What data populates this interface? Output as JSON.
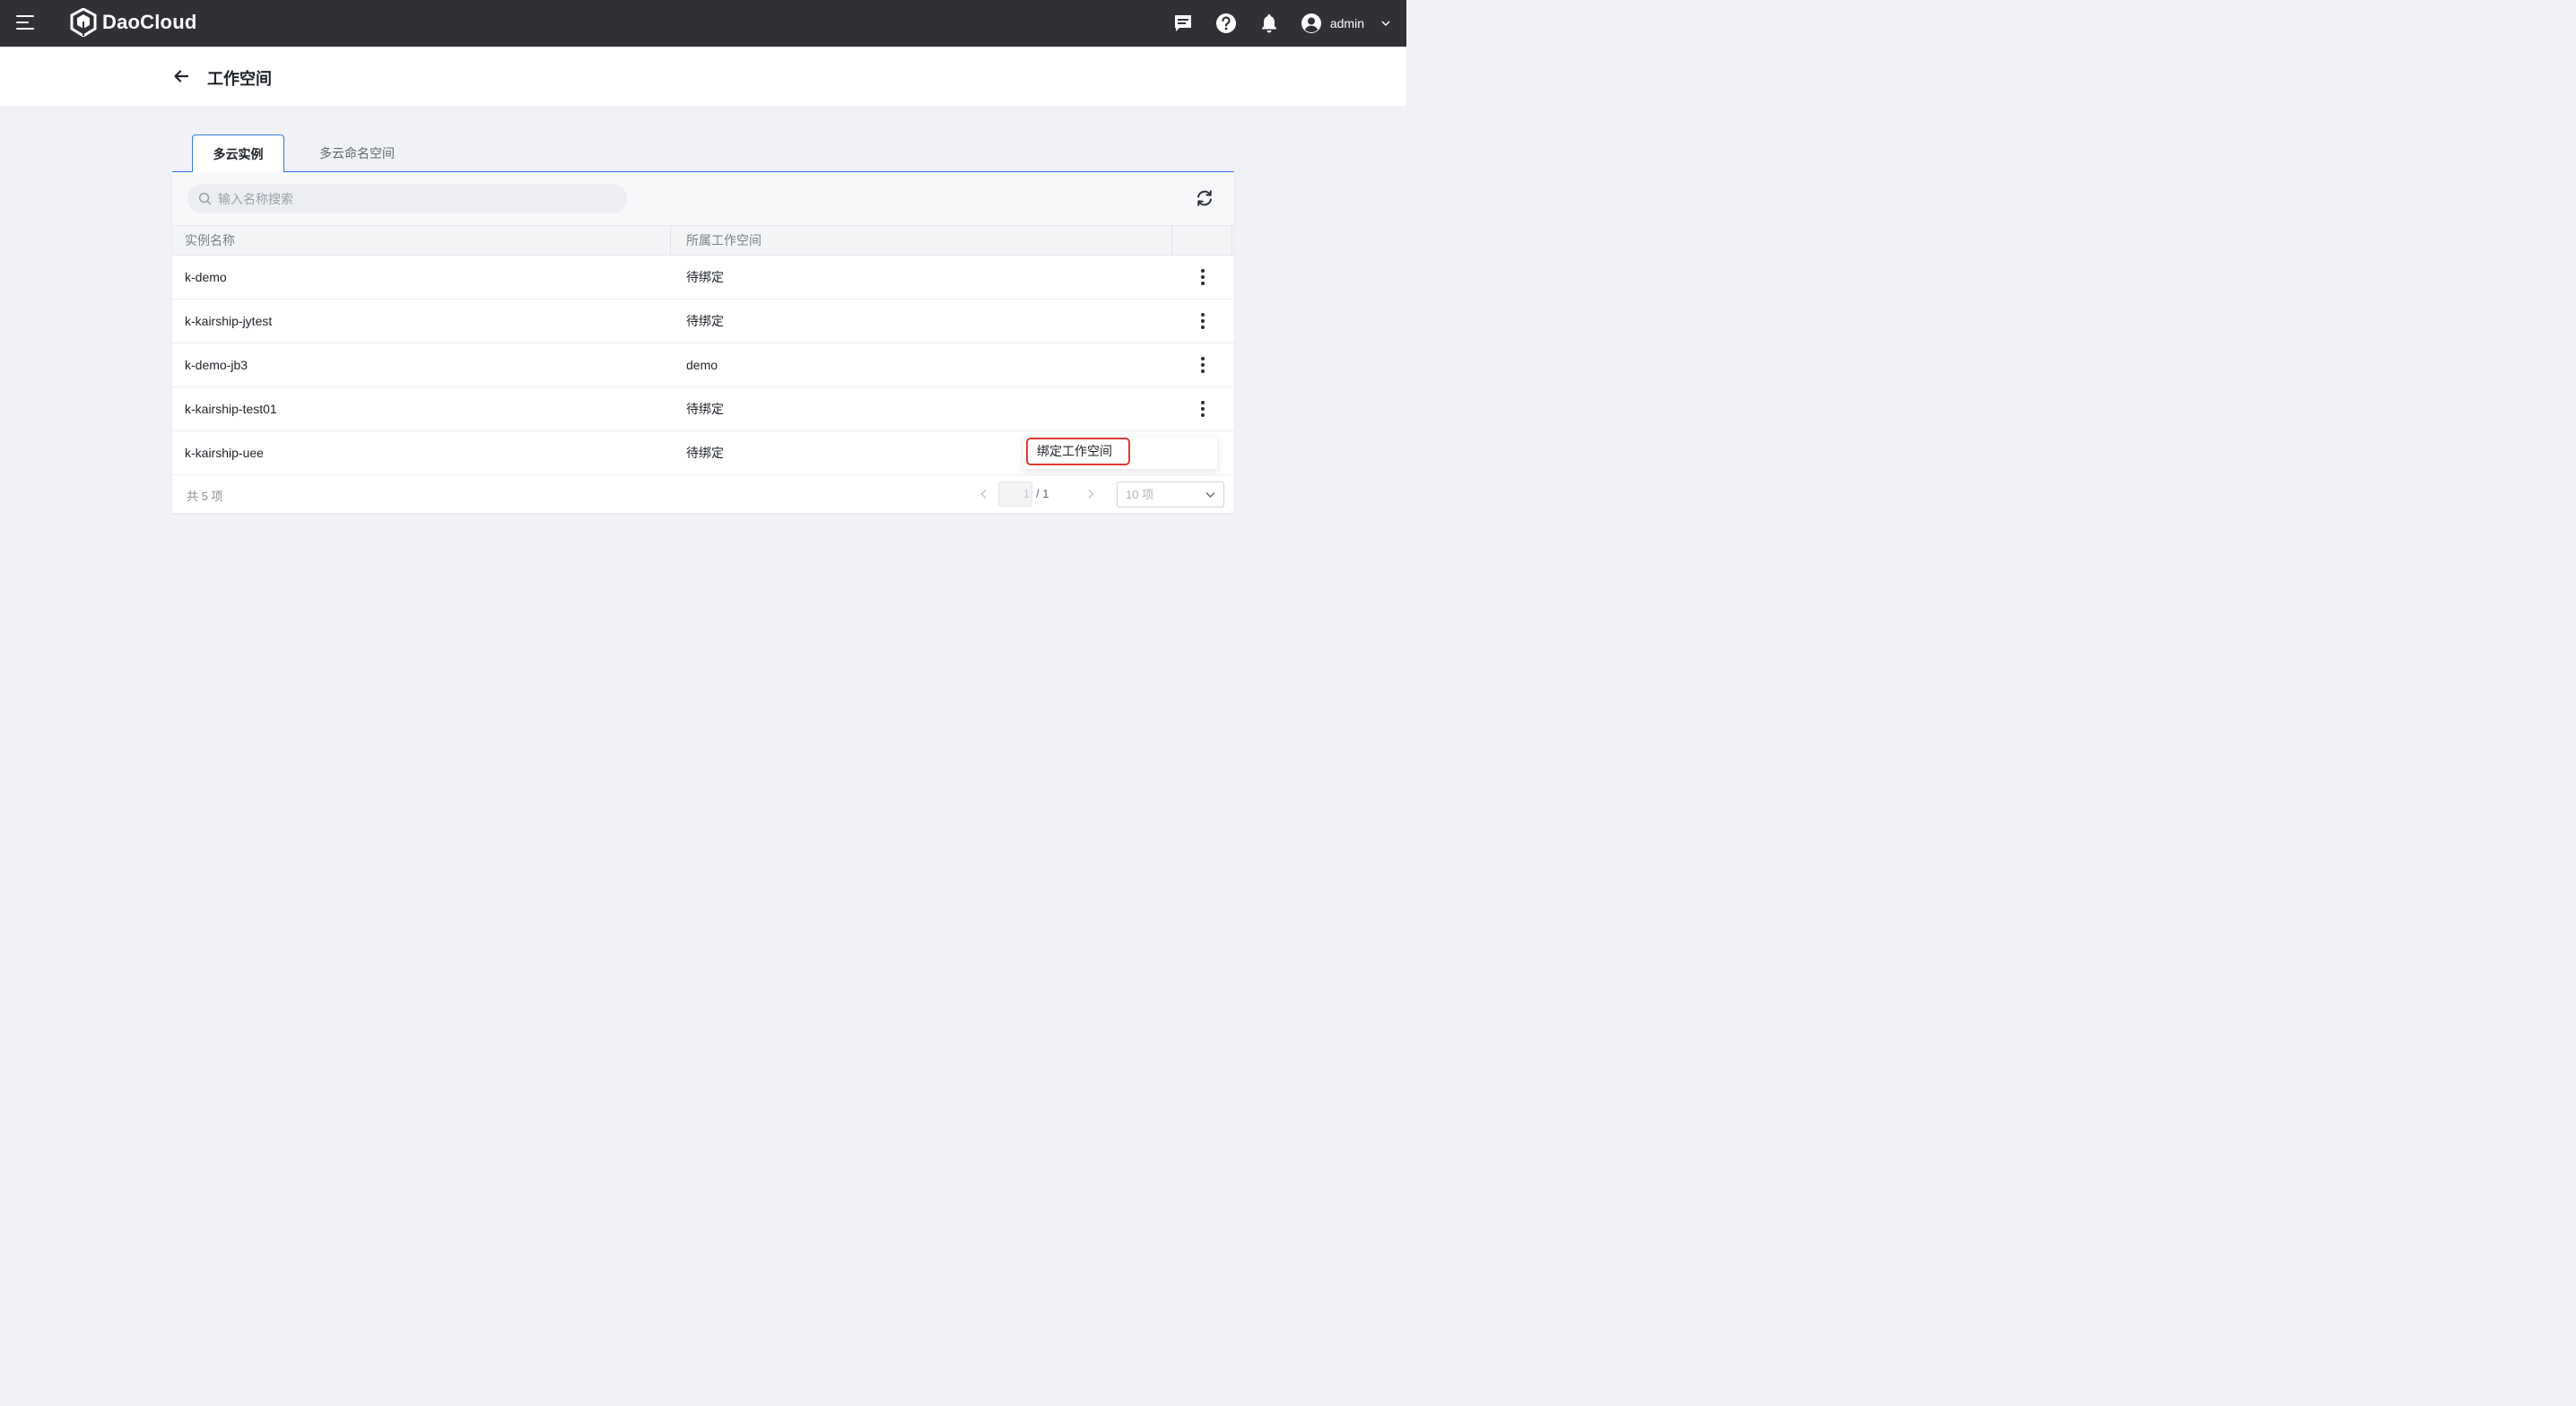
{
  "app": {
    "brand": "DaoCloud",
    "user_name": "admin"
  },
  "header": {
    "title": "工作空间"
  },
  "tabs": [
    {
      "label": "多云实例",
      "active": true
    },
    {
      "label": "多云命名空间",
      "active": false
    }
  ],
  "search": {
    "placeholder": "输入名称搜索",
    "value": ""
  },
  "table": {
    "columns": [
      "实例名称",
      "所属工作空间"
    ],
    "rows": [
      {
        "name": "k-demo",
        "workspace": "待绑定"
      },
      {
        "name": "k-kairship-jytest",
        "workspace": "待绑定"
      },
      {
        "name": "k-demo-jb3",
        "workspace": "demo"
      },
      {
        "name": "k-kairship-test01",
        "workspace": "待绑定"
      },
      {
        "name": "k-kairship-uee",
        "workspace": "待绑定"
      }
    ]
  },
  "pagination": {
    "total_label": "共 5 项",
    "current_page": "1",
    "total_pages_label": "/ 1",
    "page_size_label": "10 项"
  },
  "row_menu": {
    "items": [
      "绑定工作空间"
    ]
  },
  "colors": {
    "topbar": "#2f3136",
    "accent": "#2f7ed8",
    "highlight": "#e03a2f"
  }
}
